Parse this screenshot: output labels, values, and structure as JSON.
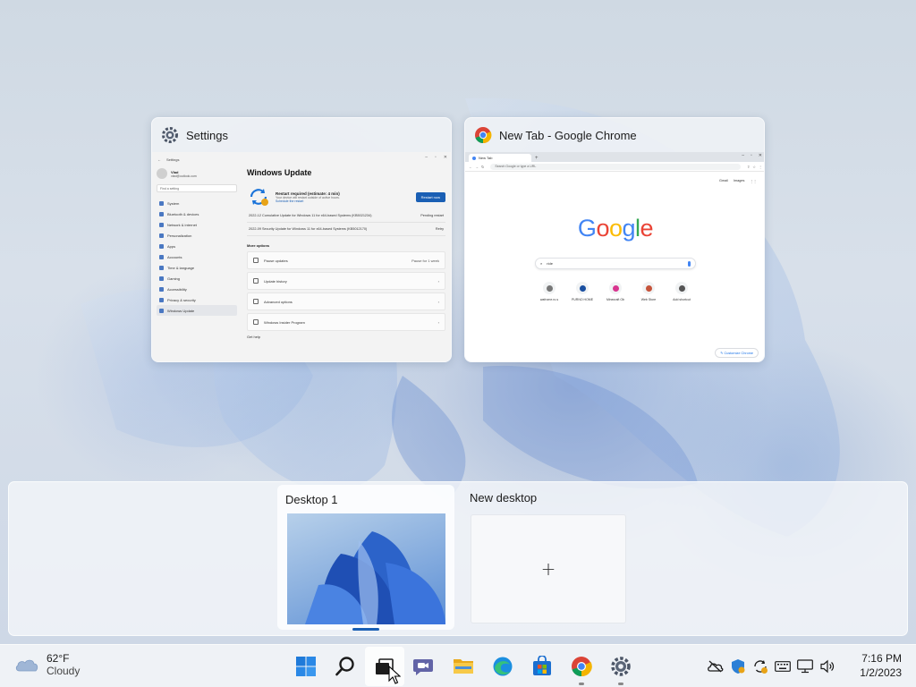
{
  "windows": [
    {
      "title": "Settings",
      "app": "settings",
      "content": {
        "breadcrumb": "Settings",
        "user_name": "Vlad",
        "user_email": "vlad@outlook.com",
        "search_placeholder": "Find a setting",
        "nav_items": [
          "System",
          "Bluetooth & devices",
          "Network & internet",
          "Personalization",
          "Apps",
          "Accounts",
          "Time & language",
          "Gaming",
          "Accessibility",
          "Privacy & security",
          "Windows Update"
        ],
        "active_nav": "Windows Update",
        "page_heading": "Windows Update",
        "restart_title": "Restart required (estimate: 4 min)",
        "restart_subtitle": "Your device will restart outside of active hours.",
        "schedule_link": "Schedule the restart",
        "restart_button": "Restart now",
        "updates": [
          {
            "name": "2022-12 Cumulative Update for Windows 11 for x64-based Systems (KB5021234)",
            "status": "Pending restart"
          },
          {
            "name": "2022-09 Security Update for Windows 11 for x64-based Systems (KB5012170)",
            "status": "Retry"
          }
        ],
        "more_options_label": "More options",
        "options": [
          {
            "label": "Pause updates",
            "right": "Pause for 1 week"
          },
          {
            "label": "Update history",
            "right": "›"
          },
          {
            "label": "Advanced options",
            "right": "›"
          },
          {
            "label": "Windows Insider Program",
            "right": "›"
          }
        ],
        "get_help": "Get help"
      }
    },
    {
      "title": "New Tab - Google Chrome",
      "app": "chrome",
      "content": {
        "tab_label": "New Tab",
        "omnibox_placeholder": "Search Google or type a URL",
        "top_links": [
          "Gmail",
          "Images"
        ],
        "logo_text": "Google",
        "search_value": "ride",
        "shortcuts": [
          "wafrome.ro.s",
          "PURNO HOME",
          "Minecraft Ob",
          "Web Store",
          "Add shortcut"
        ],
        "customize_label": "Customize Chrome"
      }
    }
  ],
  "desktops": {
    "items": [
      {
        "label": "Desktop 1",
        "active": true
      }
    ],
    "new_desktop_label": "New desktop",
    "new_desktop_icon": "+"
  },
  "taskbar": {
    "weather": {
      "temp": "62°F",
      "condition": "Cloudy",
      "icon": "cloud-icon"
    },
    "apps": [
      "start-icon",
      "search-icon",
      "task-view-icon",
      "teams-chat-icon",
      "file-explorer-icon",
      "edge-icon",
      "store-icon",
      "chrome-icon",
      "settings-icon"
    ],
    "tray_icons": [
      "onedrive-offline-icon",
      "security-icon",
      "update-icon",
      "keyboard-icon",
      "network-icon",
      "volume-icon"
    ],
    "clock": {
      "time": "7:16 PM",
      "date": "1/2/2023"
    }
  },
  "colors": {
    "accent": "#1a5fb4",
    "panel": "#f3f5f9",
    "wallpaper_blue": "#2f6fd6"
  }
}
